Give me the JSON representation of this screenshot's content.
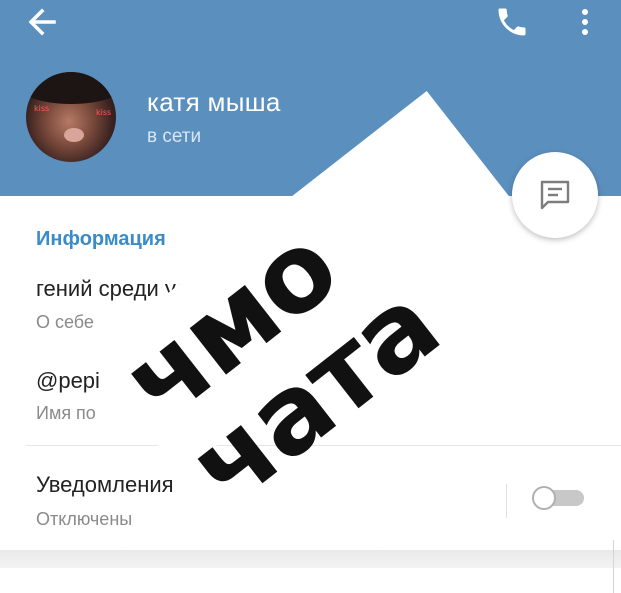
{
  "header": {
    "back_icon": "arrow-left-icon",
    "call_icon": "phone-icon",
    "menu_icon": "more-vertical-icon",
    "background_color": "#5b8fbe"
  },
  "profile": {
    "name": "катя мыша",
    "status": "в сети",
    "avatar_caption_left": "kiss",
    "avatar_caption_right": "kiss"
  },
  "fab": {
    "icon": "message-icon"
  },
  "info": {
    "section_title": "Информация",
    "about_value": "гений среди удо",
    "about_label": "О себе",
    "username_value": "@pepi",
    "username_label": "Имя по"
  },
  "notifications": {
    "title": "Уведомления",
    "subtitle": "Отключены",
    "enabled": false
  },
  "sticker": {
    "text": "чмо чата"
  },
  "colors": {
    "accent": "#3a8cc9",
    "secondary_text": "#8a8a8a"
  }
}
